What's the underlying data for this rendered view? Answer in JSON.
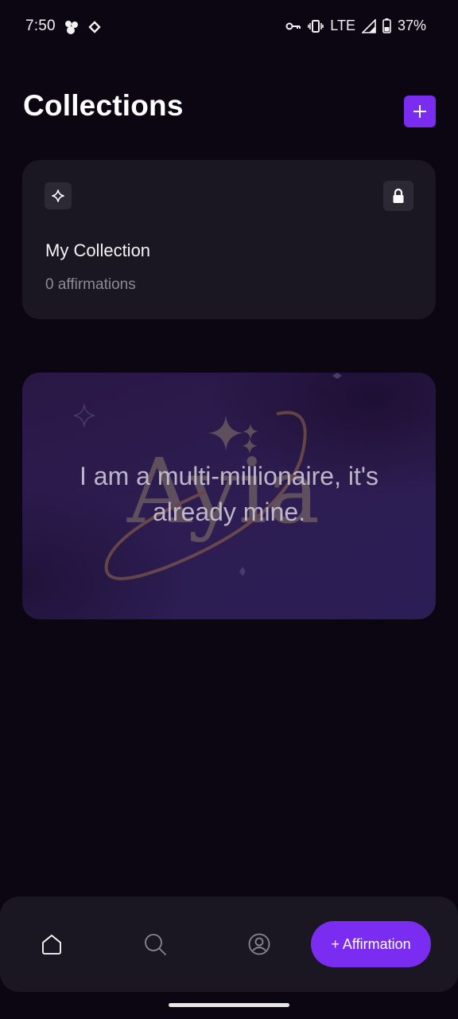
{
  "status_bar": {
    "time": "7:50",
    "network": "LTE",
    "battery": "37%"
  },
  "header": {
    "title": "Collections",
    "add_icon": "plus-icon"
  },
  "collection_card": {
    "name": "My Collection",
    "count": "0 affirmations",
    "icons": [
      "sparkle-icon",
      "lock-icon"
    ]
  },
  "affirmation_card": {
    "text": "I am a multi-millionaire, it's already mine.",
    "watermark": "Ayia"
  },
  "bottom_nav": {
    "items": [
      "home-icon",
      "search-icon",
      "profile-icon"
    ],
    "affirmation_button": "+ Affirmation"
  },
  "colors": {
    "background": "#0b0612",
    "card": "#1a1622",
    "accent": "#7a2cf0"
  }
}
